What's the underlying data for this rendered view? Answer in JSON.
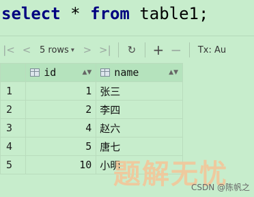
{
  "query": {
    "kw1": "select",
    "star": "*",
    "kw2": "from",
    "table": "table1;"
  },
  "toolbar": {
    "first_icon": "first-page-icon",
    "prev_icon": "prev-page-icon",
    "rows_label": "5 rows",
    "next_icon": "next-page-icon",
    "last_icon": "last-page-icon",
    "refresh_icon": "refresh-icon",
    "add_icon": "add-row-icon",
    "remove_icon": "remove-row-icon",
    "tx_label": "Tx: Au"
  },
  "grid": {
    "columns": [
      "id",
      "name"
    ],
    "rows": [
      {
        "num": "1",
        "id": "1",
        "name": "张三"
      },
      {
        "num": "2",
        "id": "2",
        "name": "李四"
      },
      {
        "num": "3",
        "id": "4",
        "name": "赵六"
      },
      {
        "num": "4",
        "id": "5",
        "name": "唐七"
      },
      {
        "num": "5",
        "id": "10",
        "name": "小明"
      }
    ]
  },
  "watermark": "题解无忧",
  "credit": "CSDN @陈帆之"
}
